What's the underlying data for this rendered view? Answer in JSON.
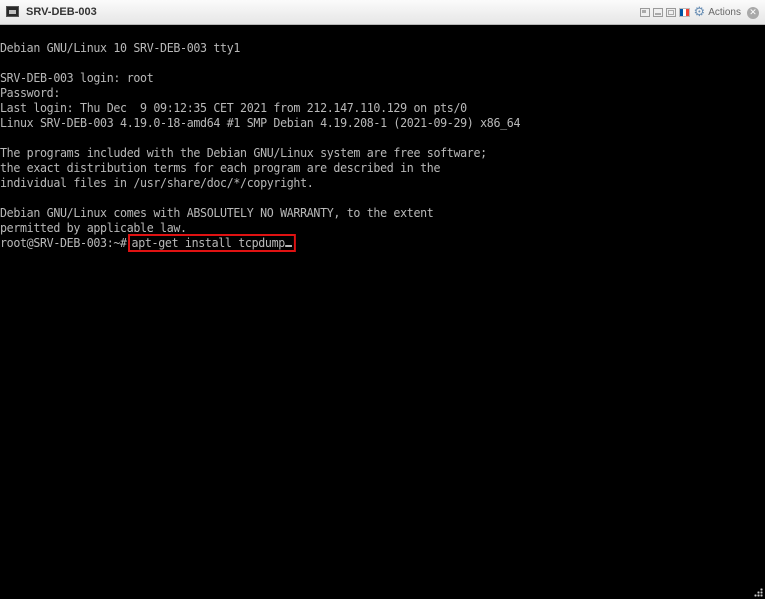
{
  "window": {
    "title": "SRV-DEB-003",
    "actions_label": "Actions",
    "close_glyph": "✕",
    "gear_glyph": "⚙",
    "flag_colors": [
      "#0055a4",
      "#ffffff",
      "#ef4135"
    ]
  },
  "terminal": {
    "lines": [
      "Debian GNU/Linux 10 SRV-DEB-003 tty1",
      "",
      "SRV-DEB-003 login: root",
      "Password:",
      "Last login: Thu Dec  9 09:12:35 CET 2021 from 212.147.110.129 on pts/0",
      "Linux SRV-DEB-003 4.19.0-18-amd64 #1 SMP Debian 4.19.208-1 (2021-09-29) x86_64",
      "",
      "The programs included with the Debian GNU/Linux system are free software;",
      "the exact distribution terms for each program are described in the",
      "individual files in /usr/share/doc/*/copyright.",
      "",
      "Debian GNU/Linux comes with ABSOLUTELY NO WARRANTY, to the extent",
      "permitted by applicable law."
    ],
    "prompt": "root@SRV-DEB-003:~#",
    "command": "apt-get install tcpdump",
    "text_color": "#b9b9b9",
    "highlight_color": "#e01212"
  }
}
